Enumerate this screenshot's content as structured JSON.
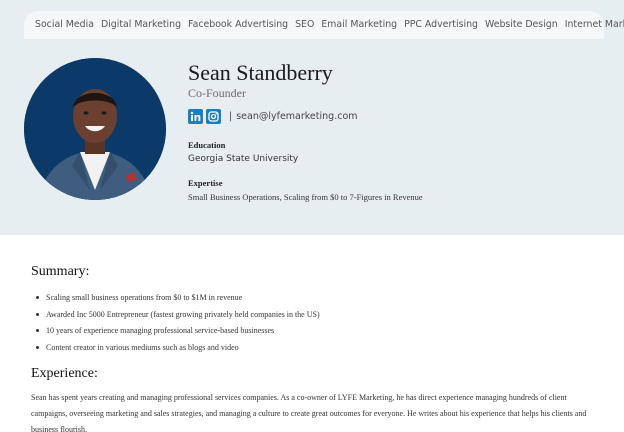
{
  "nav": {
    "items": [
      "Social Media",
      "Digital Marketing",
      "Facebook Advertising",
      "SEO",
      "Email Marketing",
      "PPC Advertising",
      "Website Design",
      "Internet Marketing"
    ]
  },
  "profile": {
    "name": "Sean Standberry",
    "role": "Co-Founder",
    "separator": "|",
    "email": "sean@lyfemarketing.com",
    "education_label": "Education",
    "education_value": "Georgia State University",
    "expertise_label": "Expertise",
    "expertise_value": "Small Business Operations, Scaling from $0 to 7-Figures in Revenue"
  },
  "social": {
    "linkedin_icon": "linkedin-icon",
    "instagram_icon": "instagram-icon",
    "color": "#1b7ec2"
  },
  "summary": {
    "heading": "Summary:",
    "items": [
      "Scaling small business operations from $0 to $1M in revenue",
      "Awarded Inc 5000 Entrepreneur (fastest growing privately held companies in the US)",
      "10 years of experience managing professional service-based businesses",
      "Content creator in various mediums such as blogs and video"
    ]
  },
  "experience": {
    "heading": "Experience:",
    "text": "Sean has spent years creating and managing professional services companies. As a co-owner of LYFE Marketing, he has direct experience managing hundreds of client campaigns, overseeing marketing and sales strategies, and managing a culture to create great outcomes for everyone. He writes about his experience that helps his clients and business flourish."
  },
  "colors": {
    "header_bg": "#e7eef2",
    "nav_bg": "#f5f7f8",
    "avatar_bg": "#0b3a68"
  }
}
